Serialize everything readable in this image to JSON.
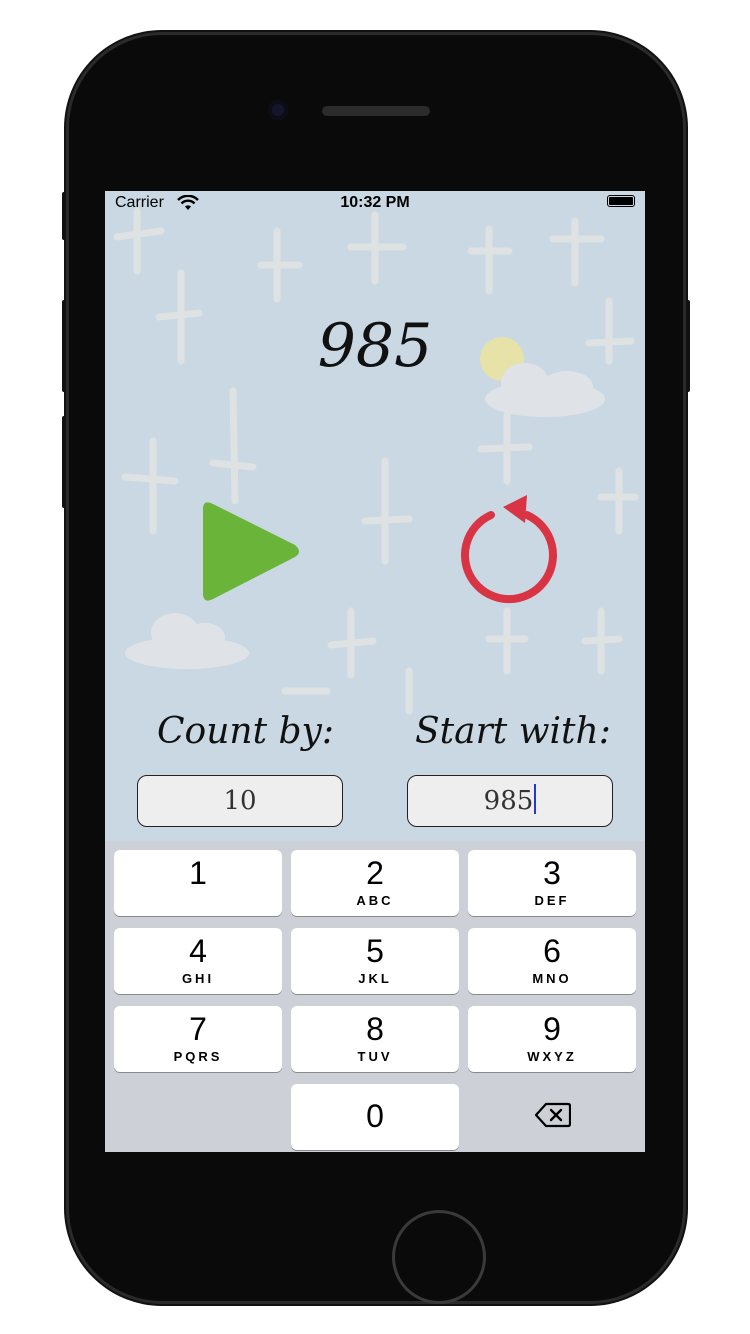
{
  "status_bar": {
    "carrier": "Carrier",
    "time": "10:32 PM"
  },
  "counter": {
    "value": "985"
  },
  "controls": {
    "play_icon": "play-icon",
    "reset_icon": "reset-icon",
    "play_color": "#6ab43a",
    "reset_color": "#d93444"
  },
  "form": {
    "count_by_label": "Count by:",
    "count_by_value": "10",
    "start_with_label": "Start with:",
    "start_with_value": "985"
  },
  "keypad": {
    "keys": [
      {
        "num": "1",
        "letters": ""
      },
      {
        "num": "2",
        "letters": "ABC"
      },
      {
        "num": "3",
        "letters": "DEF"
      },
      {
        "num": "4",
        "letters": "GHI"
      },
      {
        "num": "5",
        "letters": "JKL"
      },
      {
        "num": "6",
        "letters": "MNO"
      },
      {
        "num": "7",
        "letters": "PQRS"
      },
      {
        "num": "8",
        "letters": "TUV"
      },
      {
        "num": "9",
        "letters": "WXYZ"
      },
      {
        "num": "0",
        "letters": ""
      }
    ],
    "delete_icon": "backspace-icon"
  }
}
